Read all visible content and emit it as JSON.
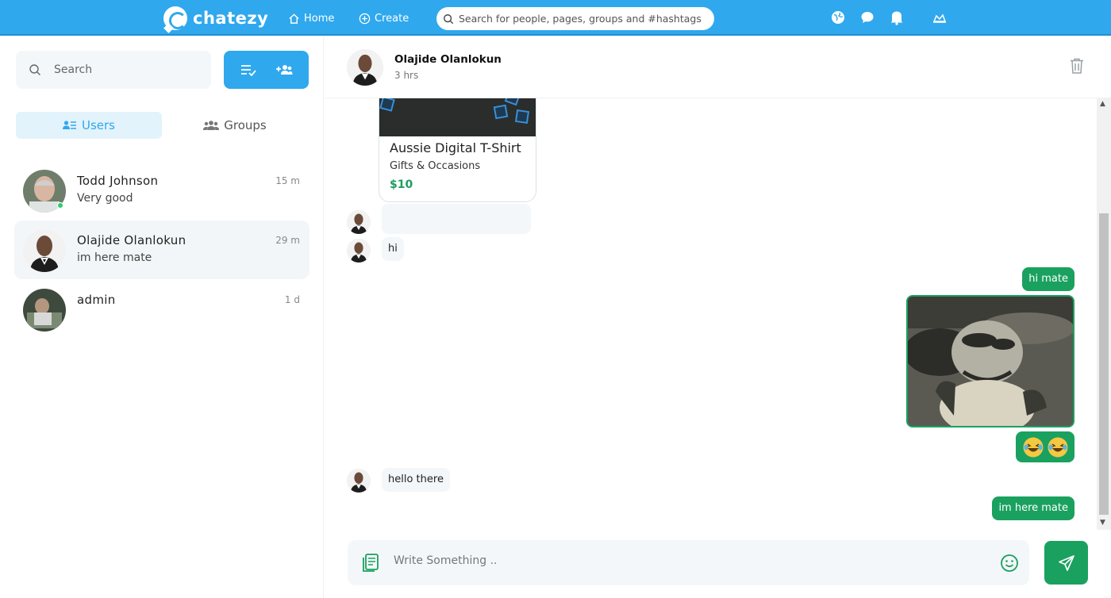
{
  "app": {
    "name": "chatezy"
  },
  "topbar": {
    "home_label": "Home",
    "create_label": "Create",
    "search_placeholder": "Search for people, pages, groups and #hashtags"
  },
  "sidebar": {
    "search_placeholder": "Search",
    "tabs": [
      {
        "label": "Users",
        "active": true
      },
      {
        "label": "Groups",
        "active": false
      }
    ],
    "conversations": [
      {
        "name": "Todd Johnson",
        "preview": "Very good",
        "time": "15 m",
        "online": true,
        "active": false
      },
      {
        "name": "Olajide Olanlokun",
        "preview": "im here mate",
        "time": "29 m",
        "online": false,
        "active": true
      },
      {
        "name": "admin",
        "preview": "",
        "time": "1 d",
        "online": false,
        "active": false
      }
    ]
  },
  "chat": {
    "contact_name": "Olajide Olanlokun",
    "contact_status": "3 hrs",
    "product": {
      "title": "Aussie Digital T-Shirt",
      "category": "Gifts & Occasions",
      "price": "$10"
    },
    "messages": {
      "in_hi": "hi",
      "out_hi_mate": "hi mate",
      "out_emoji": "😂😂",
      "in_hello": "hello there",
      "out_here": "im here mate"
    },
    "composer_placeholder": "Write Something .."
  },
  "colors": {
    "brand": "#2fa8ee",
    "sent_bubble": "#1aa15f",
    "price": "#1a9f5e"
  }
}
